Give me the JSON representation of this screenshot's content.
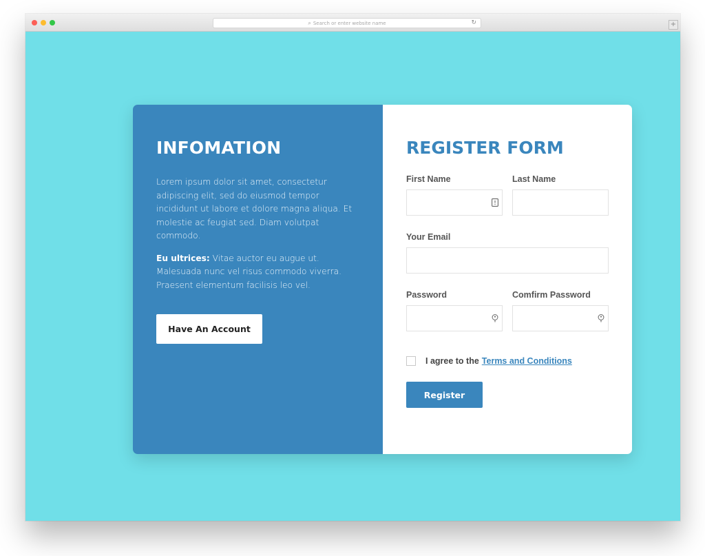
{
  "browser": {
    "address_placeholder": "Search or enter website name",
    "search_glyph": "⌕",
    "reload_glyph": "↻",
    "new_tab_glyph": "+"
  },
  "info_panel": {
    "title": "INFOMATION",
    "paragraph1": "Lorem ipsum dolor sit amet, consectetur adipiscing elit, sed do eiusmod tempor incididunt ut labore et dolore magna aliqua. Et molestie ac feugiat sed. Diam volutpat commodo.",
    "paragraph2_bold": "Eu ultrices:",
    "paragraph2_rest": " Vitae auctor eu augue ut. Malesuada nunc vel risus commodo viverra. Praesent elementum facilisis leo vel.",
    "account_button": "Have An Account"
  },
  "form": {
    "title": "REGISTER FORM",
    "first_name_label": "First Name",
    "first_name_value": "",
    "last_name_label": "Last Name",
    "last_name_value": "",
    "email_label": "Your Email",
    "email_value": "",
    "password_label": "Password",
    "password_value": "",
    "confirm_password_label": "Comfirm Password",
    "confirm_password_value": "",
    "agree_checked": false,
    "agree_text": "I agree to the",
    "terms_link": "Terms and Conditions",
    "register_button": "Register"
  },
  "colors": {
    "page_background": "#70dfe8",
    "accent": "#3a86bd",
    "panel_text": "#ffffff"
  },
  "icons": {
    "first_name_field": "autofill-card-icon",
    "password_fields": "password-key-icon"
  }
}
